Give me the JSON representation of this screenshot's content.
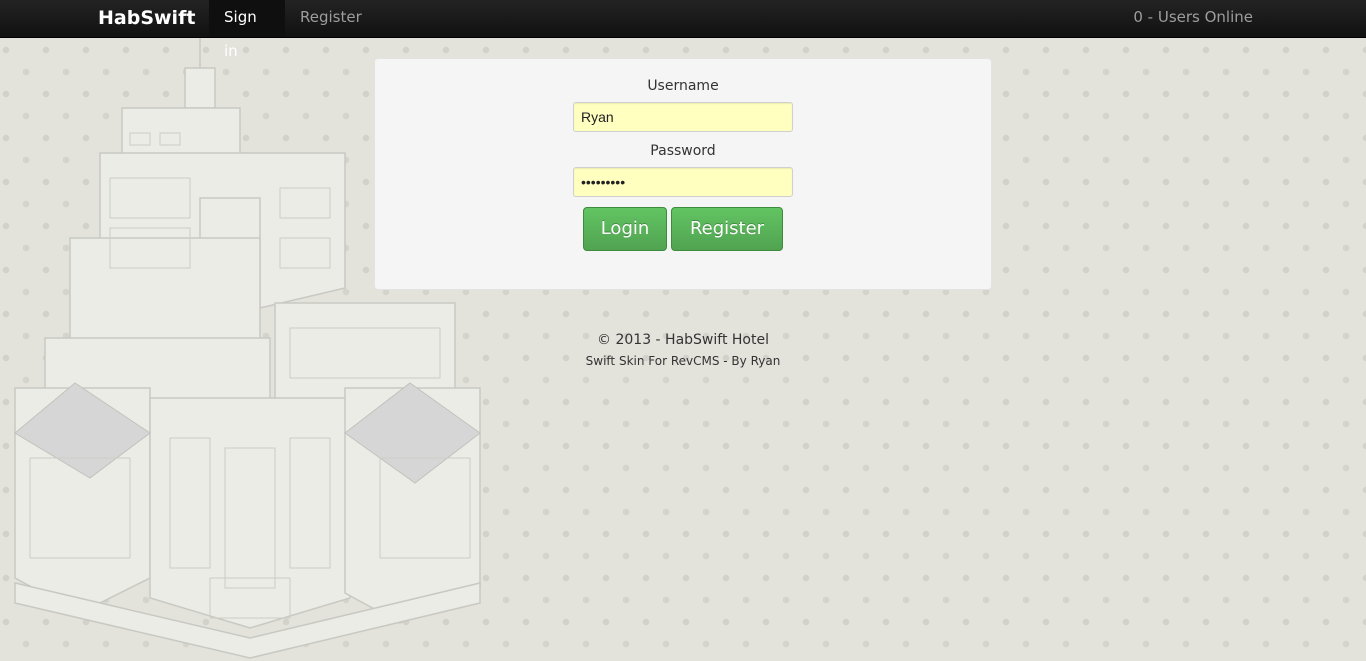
{
  "navbar": {
    "brand": "HabSwift",
    "items": [
      {
        "label": "Sign in",
        "active": true
      },
      {
        "label": "Register",
        "active": false
      }
    ],
    "online": "0 - Users Online"
  },
  "login": {
    "username_label": "Username",
    "username_value": "Ryan",
    "password_label": "Password",
    "password_value": "•••••••••",
    "login_button": "Login",
    "register_button": "Register"
  },
  "footer": {
    "copyright": "© 2013 - HabSwift Hotel",
    "credit": "Swift Skin For RevCMS - By Ryan"
  },
  "colors": {
    "navbar_bg": "#1b1b1b",
    "page_bg": "#e3e3dc",
    "panel_bg": "#f5f5f5",
    "button_green": "#5bb75b",
    "input_autofill": "#ffffc0"
  },
  "icons": {
    "background_art": "hotel-building-illustration"
  }
}
